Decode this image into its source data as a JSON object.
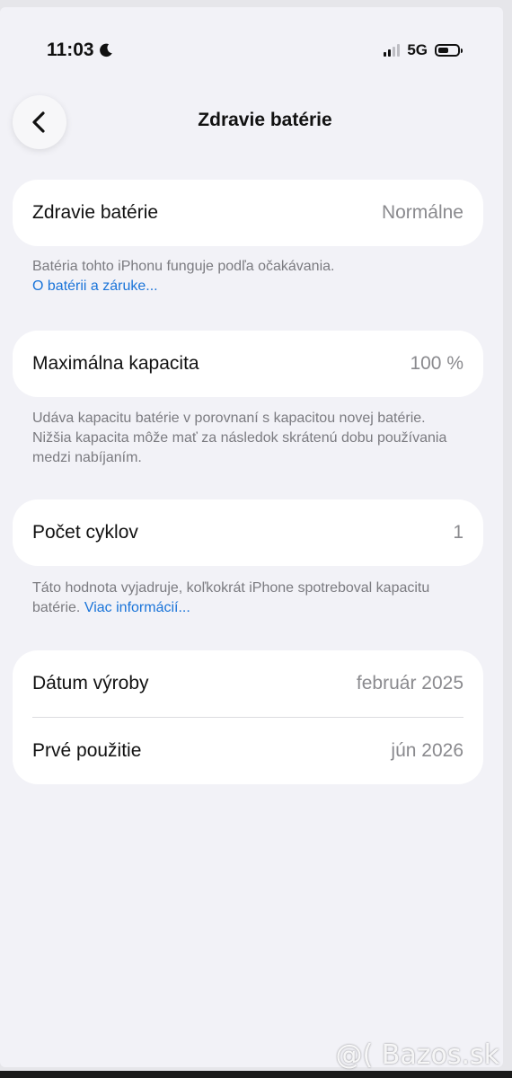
{
  "status_bar": {
    "time": "11:03",
    "network": "5G",
    "battery_level": 0.55
  },
  "nav": {
    "title": "Zdravie batérie"
  },
  "health_section": {
    "label": "Zdravie batérie",
    "value": "Normálne",
    "footnote": "Batéria tohto iPhonu funguje podľa očakávania.",
    "footnote_link": "O batérii a záruke..."
  },
  "capacity_section": {
    "label": "Maximálna kapacita",
    "value": "100 %",
    "footnote": "Udáva kapacitu batérie v porovnaní s kapacitou novej batérie. Nižšia kapacita môže mať za následok skrátenú dobu používania medzi nabíjaním."
  },
  "cycles_section": {
    "label": "Počet cyklov",
    "value": "1",
    "footnote": "Táto hodnota vyjadruje, koľkokrát iPhone spotreboval kapacitu batérie.",
    "footnote_link": "Viac informácií..."
  },
  "dates_section": {
    "manufacture_label": "Dátum výroby",
    "manufacture_value": "február 2025",
    "first_use_label": "Prvé použitie",
    "first_use_value": "jún 2026"
  },
  "watermark": {
    "text": "@( Bazos.sk"
  },
  "icons": [
    "moon-icon",
    "signal-icon",
    "battery-icon",
    "back-chevron-icon"
  ],
  "colors": {
    "background": "#f2f2f7",
    "card": "#ffffff",
    "link": "#1a74d9",
    "secondary_text": "#8a8a8e"
  }
}
